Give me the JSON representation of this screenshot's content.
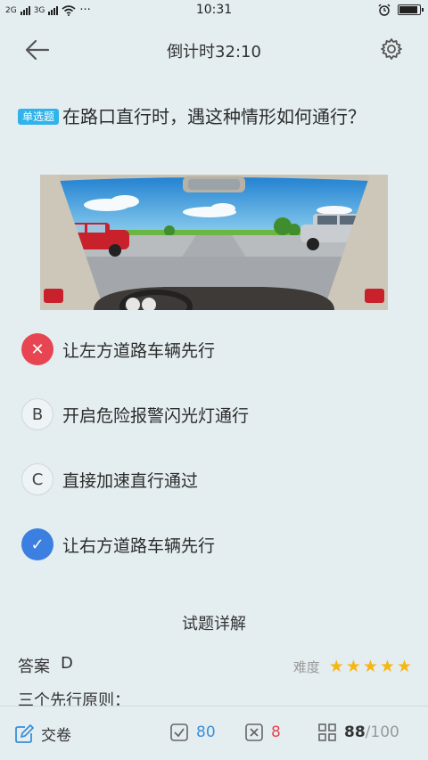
{
  "status_bar": {
    "carrier_left": "2G",
    "carrier_right": "3G",
    "time": "10:31",
    "more": "···",
    "battery_percent": 90
  },
  "header": {
    "title": "倒计时32:10"
  },
  "question": {
    "badge": "单选题",
    "text": "在路口直行时，遇这种情形如何通行？"
  },
  "options": [
    {
      "marker": "✕",
      "text": "让左方道路车辆先行",
      "state": "wrong"
    },
    {
      "marker": "B",
      "text": "开启危险报警闪光灯通行",
      "state": "normal"
    },
    {
      "marker": "C",
      "text": "直接加速直行通过",
      "state": "normal"
    },
    {
      "marker": "✓",
      "text": "让右方道路车辆先行",
      "state": "correct"
    }
  ],
  "explanation": {
    "title": "试题详解",
    "answer_label": "答案",
    "answer_value": "D",
    "difficulty_label": "难度",
    "difficulty_stars": 5,
    "star_glyph": "★",
    "text": "三个先行原则："
  },
  "bottom_bar": {
    "submit_label": "交卷",
    "right_count": "80",
    "wrong_count": "8",
    "progress_current": "88",
    "progress_total": "/100"
  },
  "colors": {
    "background": "#e4eef1",
    "accent_blue": "#3b8fd9",
    "wrong_red": "#e84552",
    "badge_blue": "#2fb3ea",
    "star": "#f6b613"
  }
}
